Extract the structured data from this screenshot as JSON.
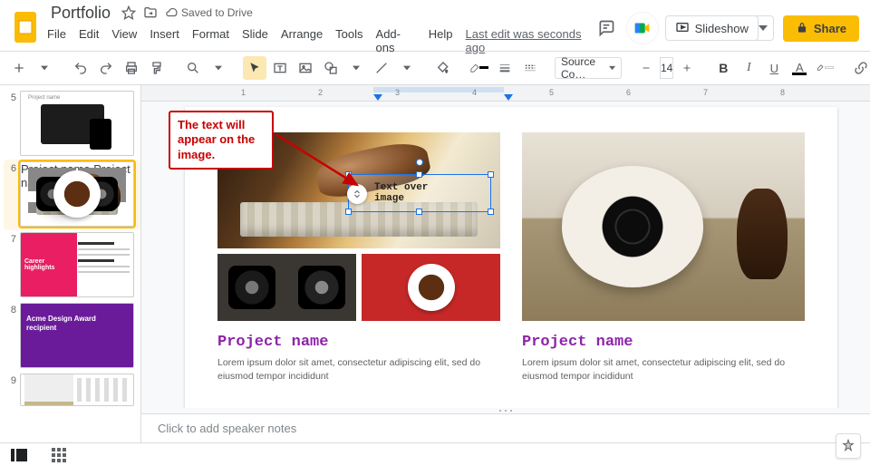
{
  "header": {
    "doc_title": "Portfolio",
    "saved_text": "Saved to Drive",
    "last_edit": "Last edit was seconds ago",
    "slideshow_label": "Slideshow",
    "share_label": "Share"
  },
  "menus": [
    "File",
    "Edit",
    "View",
    "Insert",
    "Format",
    "Slide",
    "Arrange",
    "Tools",
    "Add-ons",
    "Help"
  ],
  "toolbar": {
    "font_name": "Source Co…",
    "font_size": "14"
  },
  "ruler_labels": [
    "1",
    "2",
    "3",
    "4",
    "5",
    "6",
    "7",
    "8"
  ],
  "filmstrip": {
    "slides": [
      {
        "num": "5",
        "label": "Project name"
      },
      {
        "num": "6",
        "label": "Project name"
      },
      {
        "num": "7",
        "label": "Career highlights"
      },
      {
        "num": "8",
        "label": "Acme Design Award recipient"
      },
      {
        "num": "9",
        "label": ""
      }
    ],
    "selected_index": 1
  },
  "callout_text": "The text will appear on the image.",
  "textbox_content": "Text over\nimage",
  "slide": {
    "project_left": {
      "title": "Project name",
      "body": "Lorem ipsum dolor sit amet, consectetur adipiscing elit, sed do eiusmod tempor incididunt"
    },
    "project_right": {
      "title": "Project name",
      "body": "Lorem ipsum dolor sit amet, consectetur adipiscing elit, sed do eiusmod tempor incididunt"
    }
  },
  "notes_placeholder": "Click to add speaker notes"
}
